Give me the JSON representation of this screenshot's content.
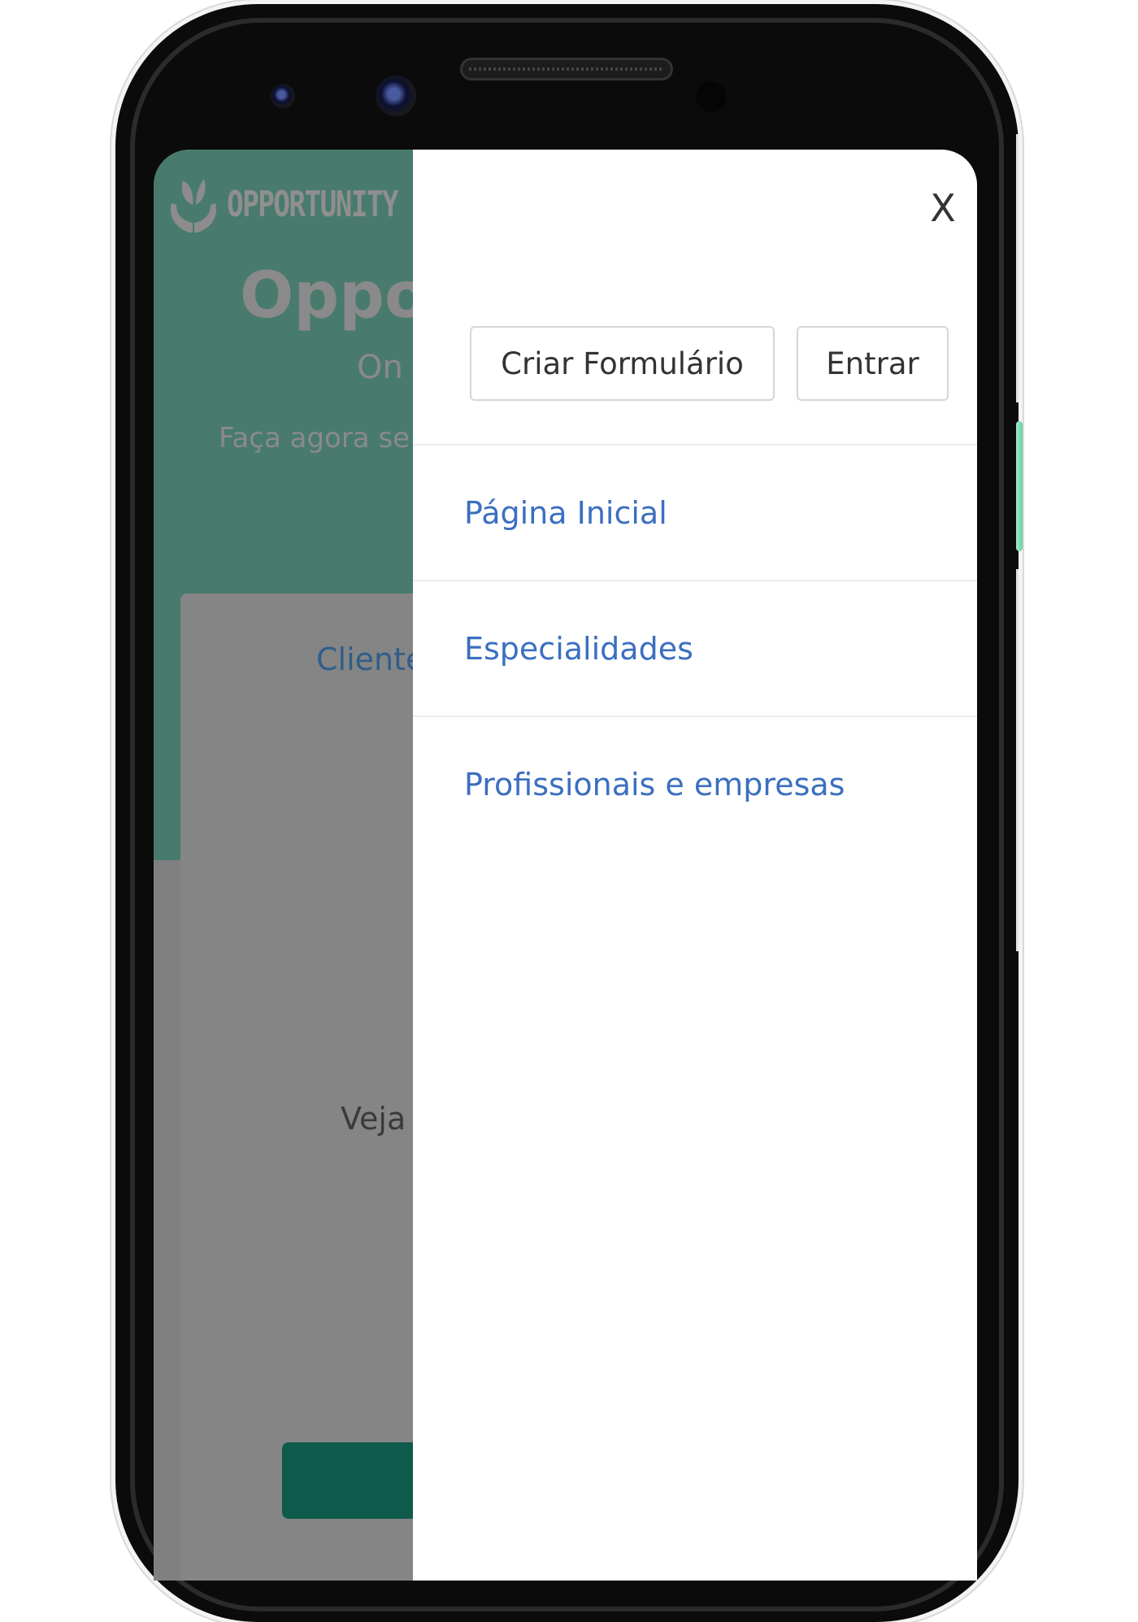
{
  "background_page": {
    "logo_text": "OPPORTUNITY",
    "title_fragment": "Oppo",
    "subtitle_fragment": "On",
    "description_fragment": "Faça agora se",
    "card_link_fragment": "Cliente",
    "card_text_fragment": "Veja ."
  },
  "menu": {
    "close_label": "X",
    "buttons": {
      "create_form": "Criar Formulário",
      "login": "Entrar"
    },
    "nav": [
      {
        "label": "Página Inicial"
      },
      {
        "label": "Especialidades"
      },
      {
        "label": "Profissionais e empresas"
      }
    ]
  },
  "colors": {
    "link": "#3b6fc0",
    "hero_overlay": "#497a6e",
    "primary_button": "#0e5a4b",
    "side_button": "#5fd6a1"
  }
}
